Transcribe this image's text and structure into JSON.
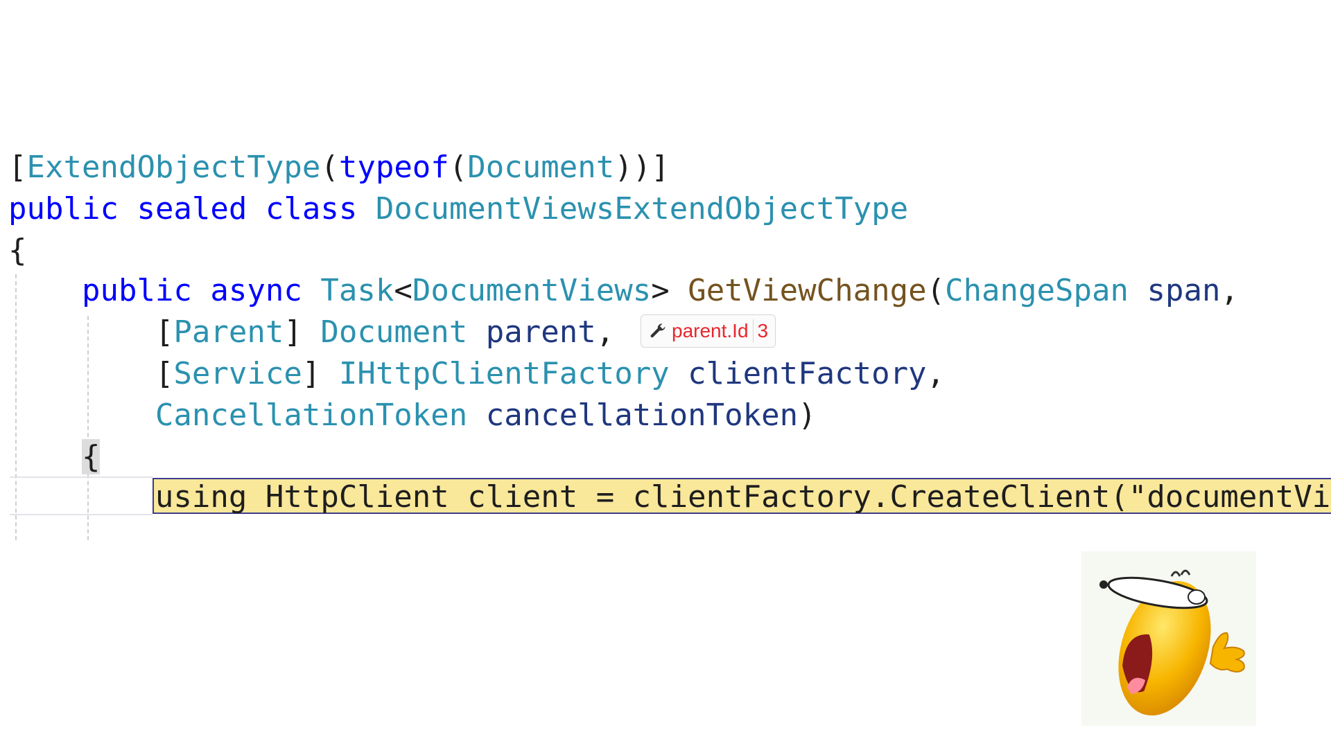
{
  "editor": {
    "lines": [
      {
        "tokens": [
          {
            "text": "[",
            "kind": "pn"
          },
          {
            "text": "ExtendObjectType",
            "kind": "ty"
          },
          {
            "text": "(",
            "kind": "pn"
          },
          {
            "text": "typeof",
            "kind": "kw"
          },
          {
            "text": "(",
            "kind": "pn"
          },
          {
            "text": "Document",
            "kind": "ty"
          },
          {
            "text": "))]",
            "kind": "pn"
          }
        ]
      },
      {
        "tokens": [
          {
            "text": "public",
            "kind": "kw"
          },
          {
            "text": " ",
            "kind": "pn"
          },
          {
            "text": "sealed",
            "kind": "kw"
          },
          {
            "text": " ",
            "kind": "pn"
          },
          {
            "text": "class",
            "kind": "kw"
          },
          {
            "text": " ",
            "kind": "pn"
          },
          {
            "text": "DocumentViewsExtendObjectType",
            "kind": "ty"
          }
        ]
      },
      {
        "tokens": [
          {
            "text": "{",
            "kind": "pn"
          }
        ]
      },
      {
        "tokens": [
          {
            "text": "    ",
            "kind": "pn"
          },
          {
            "text": "public",
            "kind": "kw"
          },
          {
            "text": " ",
            "kind": "pn"
          },
          {
            "text": "async",
            "kind": "kw"
          },
          {
            "text": " ",
            "kind": "pn"
          },
          {
            "text": "Task",
            "kind": "ty"
          },
          {
            "text": "<",
            "kind": "pn"
          },
          {
            "text": "DocumentViews",
            "kind": "ty"
          },
          {
            "text": "> ",
            "kind": "pn"
          },
          {
            "text": "GetViewChange",
            "kind": "mt"
          },
          {
            "text": "(",
            "kind": "pn"
          },
          {
            "text": "ChangeSpan",
            "kind": "ty"
          },
          {
            "text": " ",
            "kind": "pn"
          },
          {
            "text": "span",
            "kind": "pm"
          },
          {
            "text": ",",
            "kind": "pn"
          }
        ]
      },
      {
        "tokens": [
          {
            "text": "        [",
            "kind": "pn"
          },
          {
            "text": "Parent",
            "kind": "ty"
          },
          {
            "text": "] ",
            "kind": "pn"
          },
          {
            "text": "Document",
            "kind": "ty"
          },
          {
            "text": " ",
            "kind": "pn"
          },
          {
            "text": "parent",
            "kind": "pm"
          },
          {
            "text": ",",
            "kind": "pn"
          }
        ]
      },
      {
        "tokens": [
          {
            "text": "        [",
            "kind": "pn"
          },
          {
            "text": "Service",
            "kind": "ty"
          },
          {
            "text": "] ",
            "kind": "pn"
          },
          {
            "text": "IHttpClientFactory",
            "kind": "ty"
          },
          {
            "text": " ",
            "kind": "pn"
          },
          {
            "text": "clientFactory",
            "kind": "pm"
          },
          {
            "text": ",",
            "kind": "pn"
          }
        ]
      },
      {
        "tokens": [
          {
            "text": "        ",
            "kind": "pn"
          },
          {
            "text": "CancellationToken",
            "kind": "ty"
          },
          {
            "text": " ",
            "kind": "pn"
          },
          {
            "text": "cancellationToken",
            "kind": "pm"
          },
          {
            "text": ")",
            "kind": "pn"
          }
        ]
      },
      {
        "tokens": [
          {
            "text": "    ",
            "kind": "pn"
          },
          {
            "text": "{",
            "kind": "pn",
            "highlight": true
          }
        ]
      },
      {
        "tokens": [
          {
            "text": "        ",
            "kind": "pn"
          },
          {
            "text": "using HttpClient client = clientFactory.CreateClient(\"documentViews\");",
            "kind": "pn"
          }
        ]
      }
    ]
  },
  "hint": {
    "icon": "wrench-icon",
    "text": "parent.Id",
    "count": "3",
    "color": "#e8262c"
  },
  "colors": {
    "keyword": "#0000ff",
    "type": "#2b91af",
    "method": "#74531f",
    "parameter": "#1f377f",
    "current_line": "#f9e79a"
  }
}
